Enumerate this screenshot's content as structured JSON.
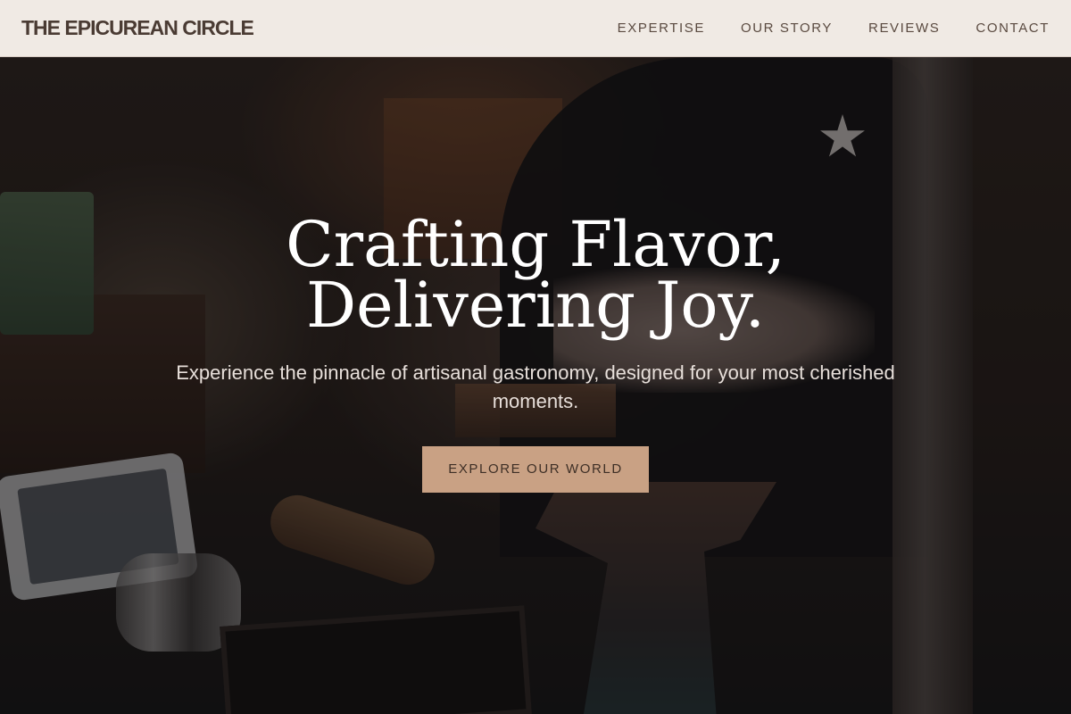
{
  "header": {
    "brand": "THE EPICUREAN CIRCLE",
    "nav": [
      {
        "label": "EXPERTISE"
      },
      {
        "label": "OUR STORY"
      },
      {
        "label": "REVIEWS"
      },
      {
        "label": "CONTACT"
      }
    ]
  },
  "hero": {
    "headline_line1": "Crafting Flavor,",
    "headline_line2": "Delivering Joy.",
    "subtext": "Experience the pinnacle of artisanal gastronomy, designed for your most cherished moments.",
    "cta_label": "EXPLORE OUR WORLD"
  },
  "colors": {
    "header_bg": "#f9f2ed",
    "brand_text": "#4a3b33",
    "cta_bg": "#c9a184",
    "cta_text": "#3e2f26"
  }
}
